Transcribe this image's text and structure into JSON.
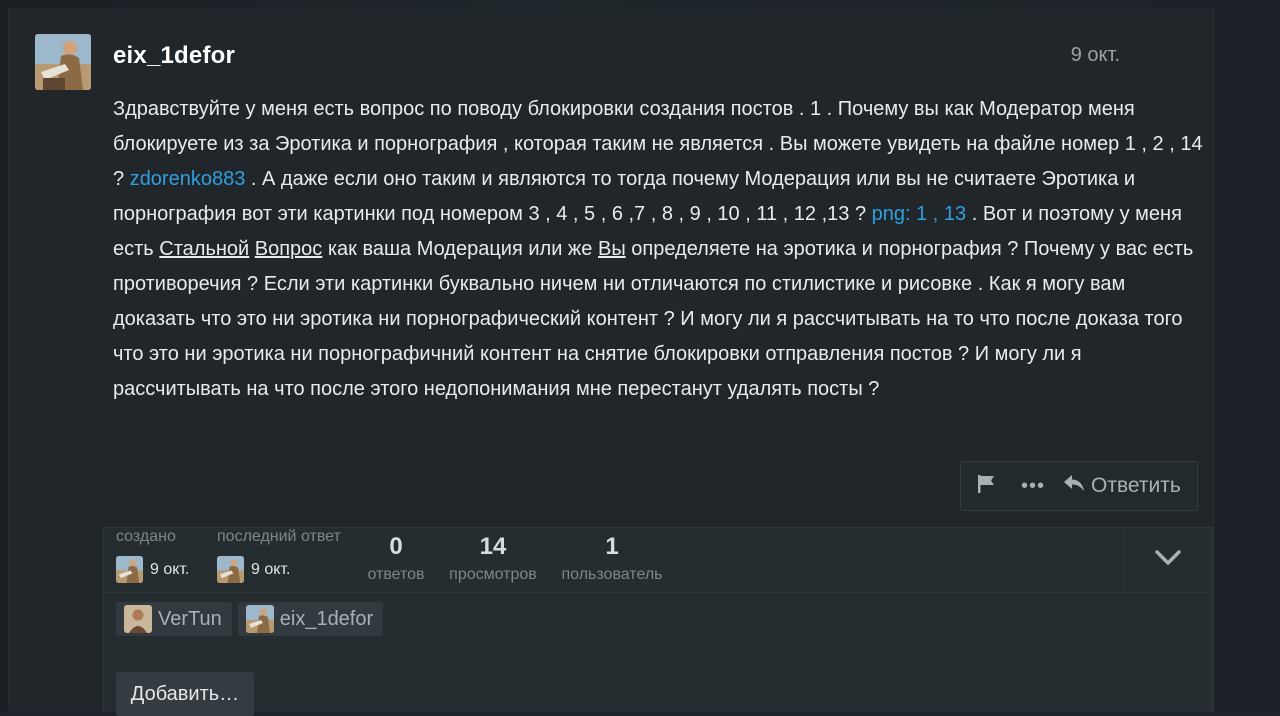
{
  "post": {
    "username": "eix_1defor",
    "date": "9 окт.",
    "body": {
      "p1": "Здравствуйте у меня есть вопрос по поводу блокировки создания постов . 1 . Почему вы как Модератор меня блокируете из за Эротика и порнография , которая таким не является . Вы можете увидеть на файле номер 1 , 2 , 14 ? ",
      "mention": "zdorenko883",
      "p2": " . А даже если оно таким и являются то тогда почему Модерация или вы не считаете Эротика и порнография вот эти картинки под номером 3 , 4 , 5 , 6 ,7 , 8 , 9 , 10 , 11 , 12 ,13 ? ",
      "link": "png: 1 , 13",
      "p3": " . Вот и поэтому у меня есть ",
      "u1": " Стальной",
      "p4": " ",
      "u2": "Вопрос",
      "p5": " как ваша Модерация или же ",
      "u3": " Вы",
      "p6": " определяете на эротика и порнография ? Почему у вас есть противоречия ? Если эти картинки буквально ничем ни отличаются по стилистике и рисовке . Как я могу вам доказать что это ни эротика ни порнографический контент ? И могу ли я рассчитывать на то что после доказа того что это ни эротика ни порнографичний контент на снятие блокировки отправления постов ? И могу ли я рассчитывать на что после этого недопонимания мне перестанут удалять посты ?"
    },
    "actions": {
      "flag_icon": "flag-icon",
      "more_icon": "ellipsis-icon",
      "more_glyph": "•••",
      "reply_icon": "reply-arrow-icon",
      "reply_label": "Ответить"
    }
  },
  "topic_map": {
    "created": {
      "label": "создано",
      "date": "9 окт."
    },
    "last_reply": {
      "label": "последний ответ",
      "date": "9 окт."
    },
    "stats": [
      {
        "value": "0",
        "label": "ответов"
      },
      {
        "value": "14",
        "label": "просмотров"
      },
      {
        "value": "1",
        "label": "пользователь"
      }
    ],
    "expand_icon": "chevron-down-icon",
    "participants": [
      "VerTun",
      "eix_1defor"
    ],
    "add_button": "Добавить…"
  },
  "colors": {
    "background": "#1d2328",
    "link": "#2f9fe0",
    "text": "#e9ebed",
    "muted": "#7e868c"
  }
}
